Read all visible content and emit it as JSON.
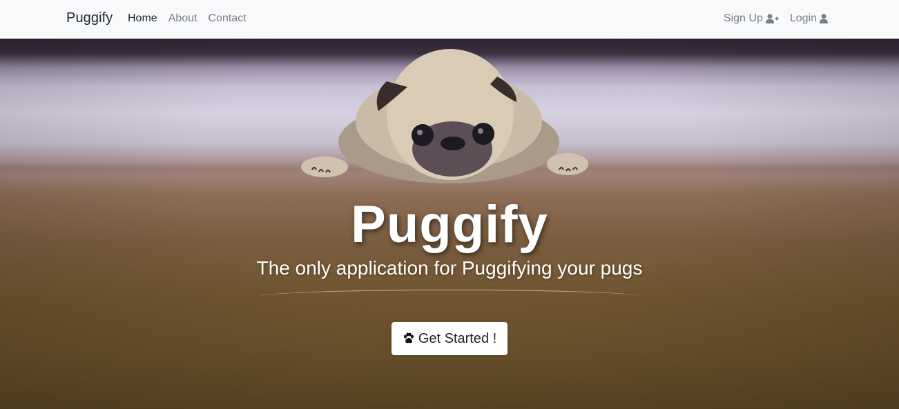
{
  "navbar": {
    "brand": "Puggify",
    "links": [
      {
        "label": "Home",
        "active": true
      },
      {
        "label": "About",
        "active": false
      },
      {
        "label": "Contact",
        "active": false
      }
    ],
    "right": [
      {
        "label": "Sign Up",
        "icon": "user-plus-icon"
      },
      {
        "label": "Login",
        "icon": "user-icon"
      }
    ]
  },
  "hero": {
    "title": "Puggify",
    "subtitle": "The only application for Puggifying your pugs",
    "cta_label": "Get Started !",
    "cta_icon": "paw-icon",
    "background_image": "pug-lying-on-floor-photo"
  },
  "colors": {
    "navbar_bg": "#f8f9fa",
    "link_active": "#212529",
    "link_muted": "#7a7e83",
    "hero_text": "#ffffff",
    "button_bg": "#ffffff"
  }
}
